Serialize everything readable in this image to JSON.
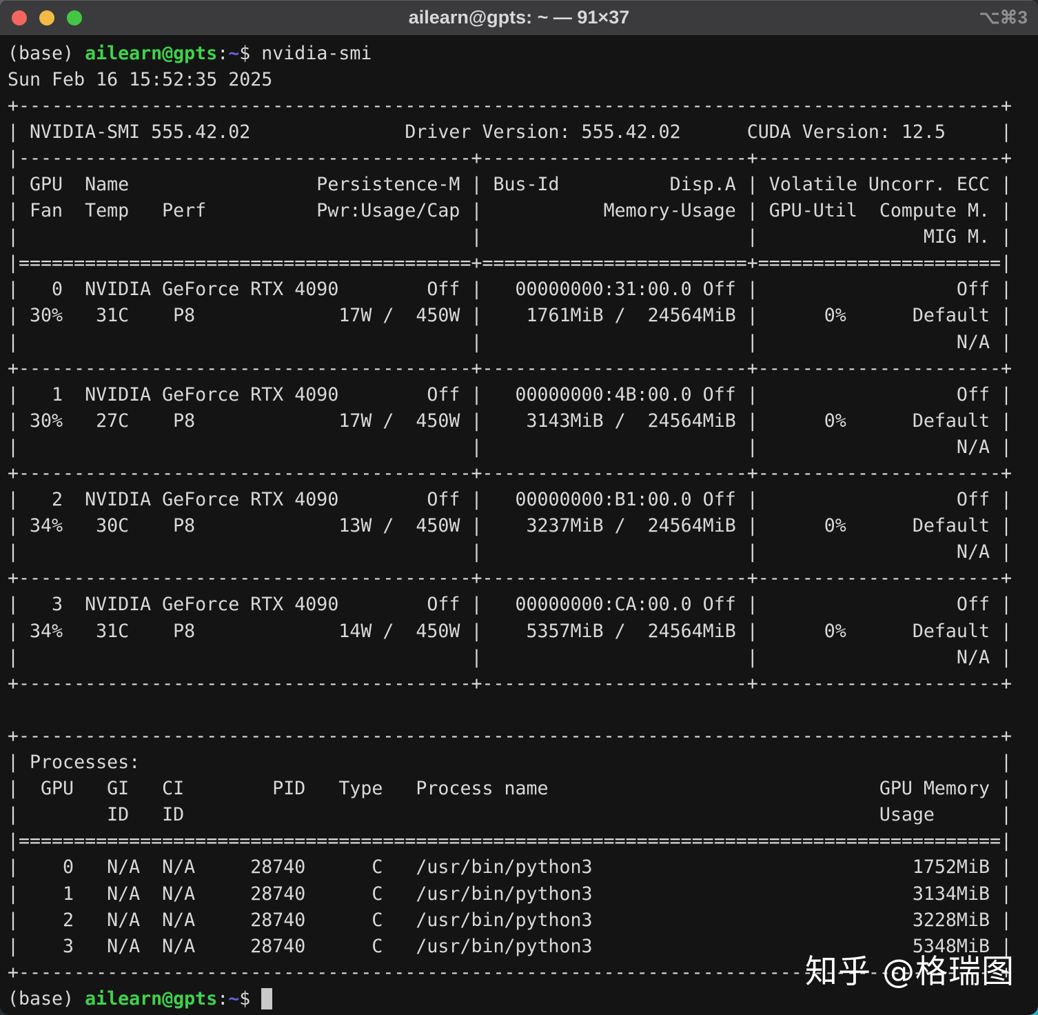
{
  "window": {
    "title": "ailearn@gpts: ~ — 91×37",
    "shortcut": "⌥⌘3"
  },
  "colors": {
    "titlebar_bg": "#3b3b3d",
    "terminal_bg": "#141414",
    "text": "#d9d9d9",
    "prompt_user": "#3fd24c",
    "prompt_path": "#6262dd",
    "cursor": "#c9c9c9",
    "light_red": "#f2665e",
    "light_yellow": "#f3bb45",
    "light_green": "#43c644"
  },
  "watermark": {
    "text": "知乎 @格瑞图"
  },
  "nvidia_smi": {
    "command": "nvidia-smi",
    "timestamp": "Sun Feb 16 15:52:35 2025",
    "smi_version": "555.42.02",
    "driver_version": "555.42.02",
    "cuda_version": "12.5",
    "gpus": [
      {
        "id": 0,
        "name": "NVIDIA GeForce RTX 4090",
        "persistence": "Off",
        "fan": "30%",
        "temp": "31C",
        "perf": "P8",
        "power": "17W / 450W",
        "bus_id": "00000000:31:00.0",
        "disp_a": "Off",
        "memory": "1761MiB / 24564MiB",
        "gpu_util": "0%",
        "compute_mode": "Default",
        "ecc": "Off",
        "mig": "N/A"
      },
      {
        "id": 1,
        "name": "NVIDIA GeForce RTX 4090",
        "persistence": "Off",
        "fan": "30%",
        "temp": "27C",
        "perf": "P8",
        "power": "17W / 450W",
        "bus_id": "00000000:4B:00.0",
        "disp_a": "Off",
        "memory": "3143MiB / 24564MiB",
        "gpu_util": "0%",
        "compute_mode": "Default",
        "ecc": "Off",
        "mig": "N/A"
      },
      {
        "id": 2,
        "name": "NVIDIA GeForce RTX 4090",
        "persistence": "Off",
        "fan": "34%",
        "temp": "30C",
        "perf": "P8",
        "power": "13W / 450W",
        "bus_id": "00000000:B1:00.0",
        "disp_a": "Off",
        "memory": "3237MiB / 24564MiB",
        "gpu_util": "0%",
        "compute_mode": "Default",
        "ecc": "Off",
        "mig": "N/A"
      },
      {
        "id": 3,
        "name": "NVIDIA GeForce RTX 4090",
        "persistence": "Off",
        "fan": "34%",
        "temp": "31C",
        "perf": "P8",
        "power": "14W / 450W",
        "bus_id": "00000000:CA:00.0",
        "disp_a": "Off",
        "memory": "5357MiB / 24564MiB",
        "gpu_util": "0%",
        "compute_mode": "Default",
        "ecc": "Off",
        "mig": "N/A"
      }
    ],
    "processes": [
      {
        "gpu": 0,
        "gi_id": "N/A",
        "ci_id": "N/A",
        "pid": "28740",
        "type": "C",
        "name": "/usr/bin/python3",
        "memory": "1752MiB"
      },
      {
        "gpu": 1,
        "gi_id": "N/A",
        "ci_id": "N/A",
        "pid": "28740",
        "type": "C",
        "name": "/usr/bin/python3",
        "memory": "3134MiB"
      },
      {
        "gpu": 2,
        "gi_id": "N/A",
        "ci_id": "N/A",
        "pid": "28740",
        "type": "C",
        "name": "/usr/bin/python3",
        "memory": "3228MiB"
      },
      {
        "gpu": 3,
        "gi_id": "N/A",
        "ci_id": "N/A",
        "pid": "28740",
        "type": "C",
        "name": "/usr/bin/python3",
        "memory": "5348MiB"
      }
    ]
  },
  "terminal": {
    "lines": [
      [
        {
          "t": "(base) ",
          "c": "fg"
        },
        {
          "t": "ailearn@gpts",
          "c": "user"
        },
        {
          "t": ":",
          "c": "fg"
        },
        {
          "t": "~",
          "c": "path"
        },
        {
          "t": "$ nvidia-smi",
          "c": "fg"
        }
      ],
      "Sun Feb 16 15:52:35 2025",
      "+-----------------------------------------------------------------------------------------+",
      "| NVIDIA-SMI 555.42.02              Driver Version: 555.42.02      CUDA Version: 12.5     |",
      "|-----------------------------------------+------------------------+----------------------+",
      "| GPU  Name                 Persistence-M | Bus-Id          Disp.A | Volatile Uncorr. ECC |",
      "| Fan  Temp   Perf          Pwr:Usage/Cap |           Memory-Usage | GPU-Util  Compute M. |",
      "|                                         |                        |               MIG M. |",
      "|=========================================+========================+======================|",
      "|   0  NVIDIA GeForce RTX 4090        Off |   00000000:31:00.0 Off |                  Off |",
      "| 30%   31C    P8             17W /  450W |    1761MiB /  24564MiB |      0%      Default |",
      "|                                         |                        |                  N/A |",
      "+-----------------------------------------+------------------------+----------------------+",
      "|   1  NVIDIA GeForce RTX 4090        Off |   00000000:4B:00.0 Off |                  Off |",
      "| 30%   27C    P8             17W /  450W |    3143MiB /  24564MiB |      0%      Default |",
      "|                                         |                        |                  N/A |",
      "+-----------------------------------------+------------------------+----------------------+",
      "|   2  NVIDIA GeForce RTX 4090        Off |   00000000:B1:00.0 Off |                  Off |",
      "| 34%   30C    P8             13W /  450W |    3237MiB /  24564MiB |      0%      Default |",
      "|                                         |                        |                  N/A |",
      "+-----------------------------------------+------------------------+----------------------+",
      "|   3  NVIDIA GeForce RTX 4090        Off |   00000000:CA:00.0 Off |                  Off |",
      "| 34%   31C    P8             14W /  450W |    5357MiB /  24564MiB |      0%      Default |",
      "|                                         |                        |                  N/A |",
      "+-----------------------------------------+------------------------+----------------------+",
      "",
      "+-----------------------------------------------------------------------------------------+",
      "| Processes:                                                                              |",
      "|  GPU   GI   CI        PID   Type   Process name                              GPU Memory |",
      "|        ID   ID                                                               Usage      |",
      "|=========================================================================================|",
      "|    0   N/A  N/A     28740      C   /usr/bin/python3                             1752MiB |",
      "|    1   N/A  N/A     28740      C   /usr/bin/python3                             3134MiB |",
      "|    2   N/A  N/A     28740      C   /usr/bin/python3                             3228MiB |",
      "|    3   N/A  N/A     28740      C   /usr/bin/python3                             5348MiB |",
      "+-----------------------------------------------------------------------------------------+",
      [
        {
          "t": "(base) ",
          "c": "fg"
        },
        {
          "t": "ailearn@gpts",
          "c": "user"
        },
        {
          "t": ":",
          "c": "fg"
        },
        {
          "t": "~",
          "c": "path"
        },
        {
          "t": "$ ",
          "c": "fg"
        },
        {
          "t": " ",
          "c": "cursor"
        }
      ]
    ]
  }
}
